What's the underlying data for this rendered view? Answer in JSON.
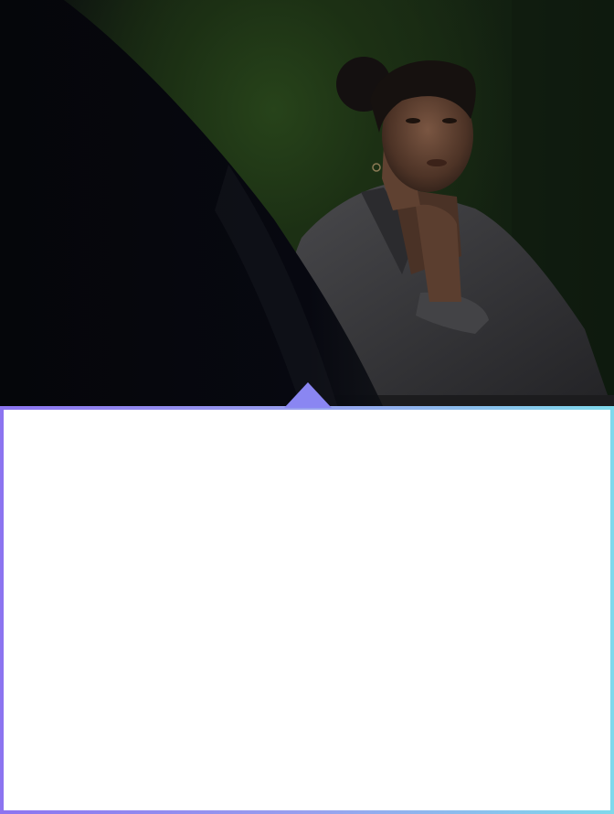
{
  "hero": {
    "image_subject": "person-portrait-photo",
    "colors": {
      "background_dark": "#0a0b0d",
      "background_green": "#27431a",
      "jacket": "#3d3d40",
      "skin": "#6a4a37"
    }
  },
  "card": {
    "border_colors": [
      "#8c74f0",
      "#98a0ee",
      "#7fd9ec"
    ],
    "pointer_color": "#8a86f2",
    "background": "#ffffff"
  }
}
